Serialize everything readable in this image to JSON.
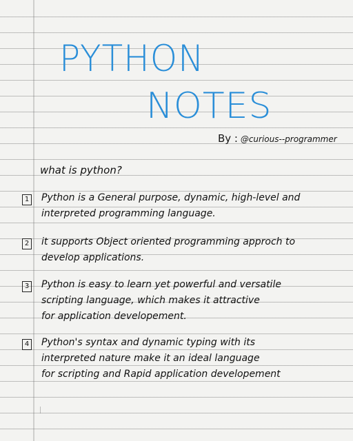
{
  "title": {
    "line1": "PYTHON",
    "line2": "NOTES"
  },
  "byline": {
    "prefix": "By :",
    "author": "@curious--programmer"
  },
  "heading": "what is python?",
  "points": [
    {
      "num": "1",
      "lines": [
        "Python is a General purpose, dynamic, high-level and",
        "interpreted programming language."
      ]
    },
    {
      "num": "2",
      "lines": [
        "it supports Object oriented programming approch to",
        "develop applications."
      ]
    },
    {
      "num": "3",
      "lines": [
        "Python is easy to learn yet powerful and versatile",
        "scripting language, which makes it attractive",
        "for application developement."
      ]
    },
    {
      "num": "4",
      "lines": [
        "Python's syntax and dynamic typing with its",
        "interpreted nature make it an ideal language",
        "for scripting and Rapid application developement"
      ]
    }
  ],
  "colors": {
    "title_ink": "#2a8ed8",
    "body_ink": "#111111",
    "paper": "#f3f3f1"
  }
}
